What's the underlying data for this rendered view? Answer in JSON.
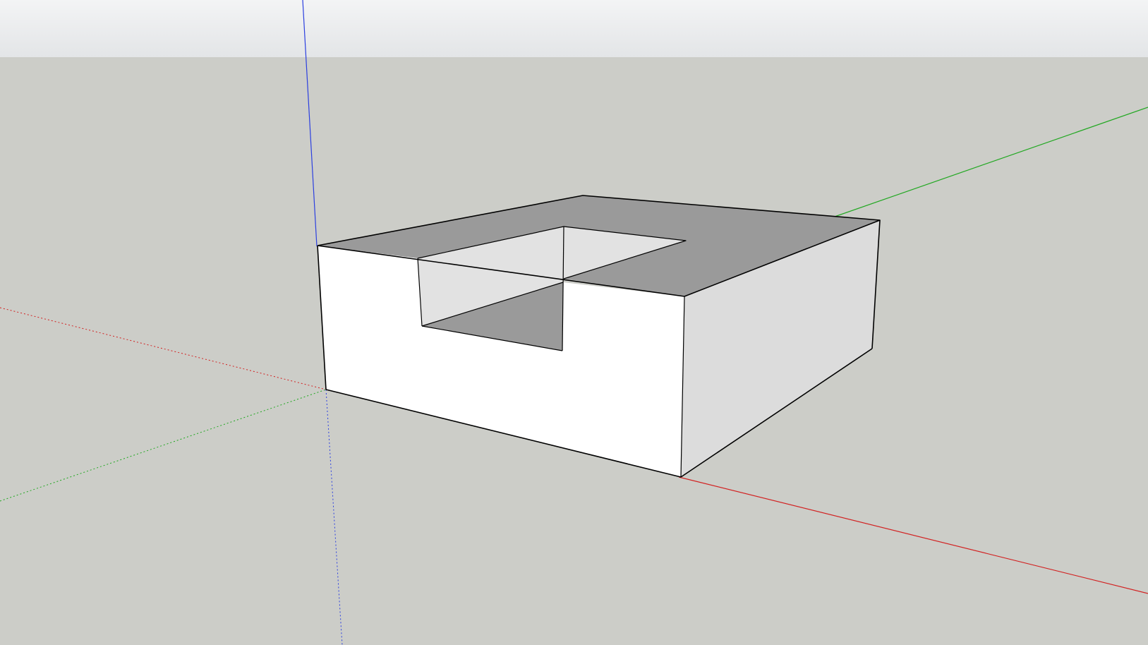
{
  "viewport": {
    "sky_top_color": "#f3f4f5",
    "sky_bottom_color": "#e3e5e7",
    "ground_color": "#cccdc8",
    "axis_colors": {
      "red": "#d22222",
      "green": "#22a822",
      "blue": "#2b3fe0"
    },
    "face_colors": {
      "front": "#ffffff",
      "side": "#dcdcdc",
      "top": "#9a9a9a",
      "notch_floor": "#9a9a9a",
      "notch_wall": "#e2e2e2"
    },
    "edge_color": "#000000",
    "model": "notched-box-solid"
  }
}
